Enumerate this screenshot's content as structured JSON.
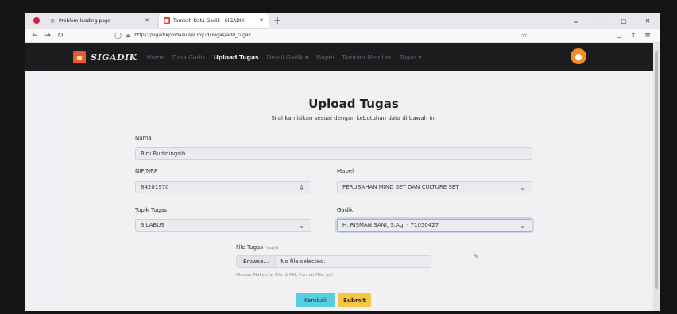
{
  "browser": {
    "tabs": [
      {
        "label": "Problem loading page",
        "icon": "clock-icon"
      },
      {
        "label": "Tambah Data Gadik - SIGADIK",
        "icon": "sigadik-favicon"
      }
    ],
    "new_tab": "+",
    "url": "https://sigadikpoldasulsel.my.id/Tugas/add_tugas"
  },
  "site": {
    "brand": "SIGADIK",
    "menu": [
      {
        "label": "Home",
        "active": false
      },
      {
        "label": "Data Gadik",
        "active": false
      },
      {
        "label": "Upload Tugas",
        "active": true
      },
      {
        "label": "Detail Gadik",
        "active": false,
        "dropdown": true
      },
      {
        "label": "Mapel",
        "active": false
      },
      {
        "label": "Tambah Member",
        "active": false
      },
      {
        "label": "Tugas",
        "active": false,
        "dropdown": true
      }
    ]
  },
  "form": {
    "title": "Upload Tugas",
    "subtitle": "Silahkan isikan sesuai dengan kebutuhan data di bawah ini",
    "nama_label": "Nama",
    "nama_value": "Rini Budiningsih",
    "nip_label": "NIP/NRP",
    "nip_value": "84201970",
    "mapel_label": "Mapel",
    "mapel_value": "PERUBAHAN MIND SET DAN CULTURE SET",
    "topik_label": "Topik Tugas",
    "topik_value": "SILABUS",
    "gadik_label": "Gadik",
    "gadik_value": "H. RISMAN SANI, S.Ag. - 71050427",
    "file_label": "File Tugas",
    "file_required": "*wajib",
    "browse_label": "Browse...",
    "file_status": "No file selected.",
    "file_hint": "Ukuran Maksimal File: 2 MB, Format File: pdf",
    "kembali_label": "Kembali",
    "submit_label": "Submit"
  }
}
